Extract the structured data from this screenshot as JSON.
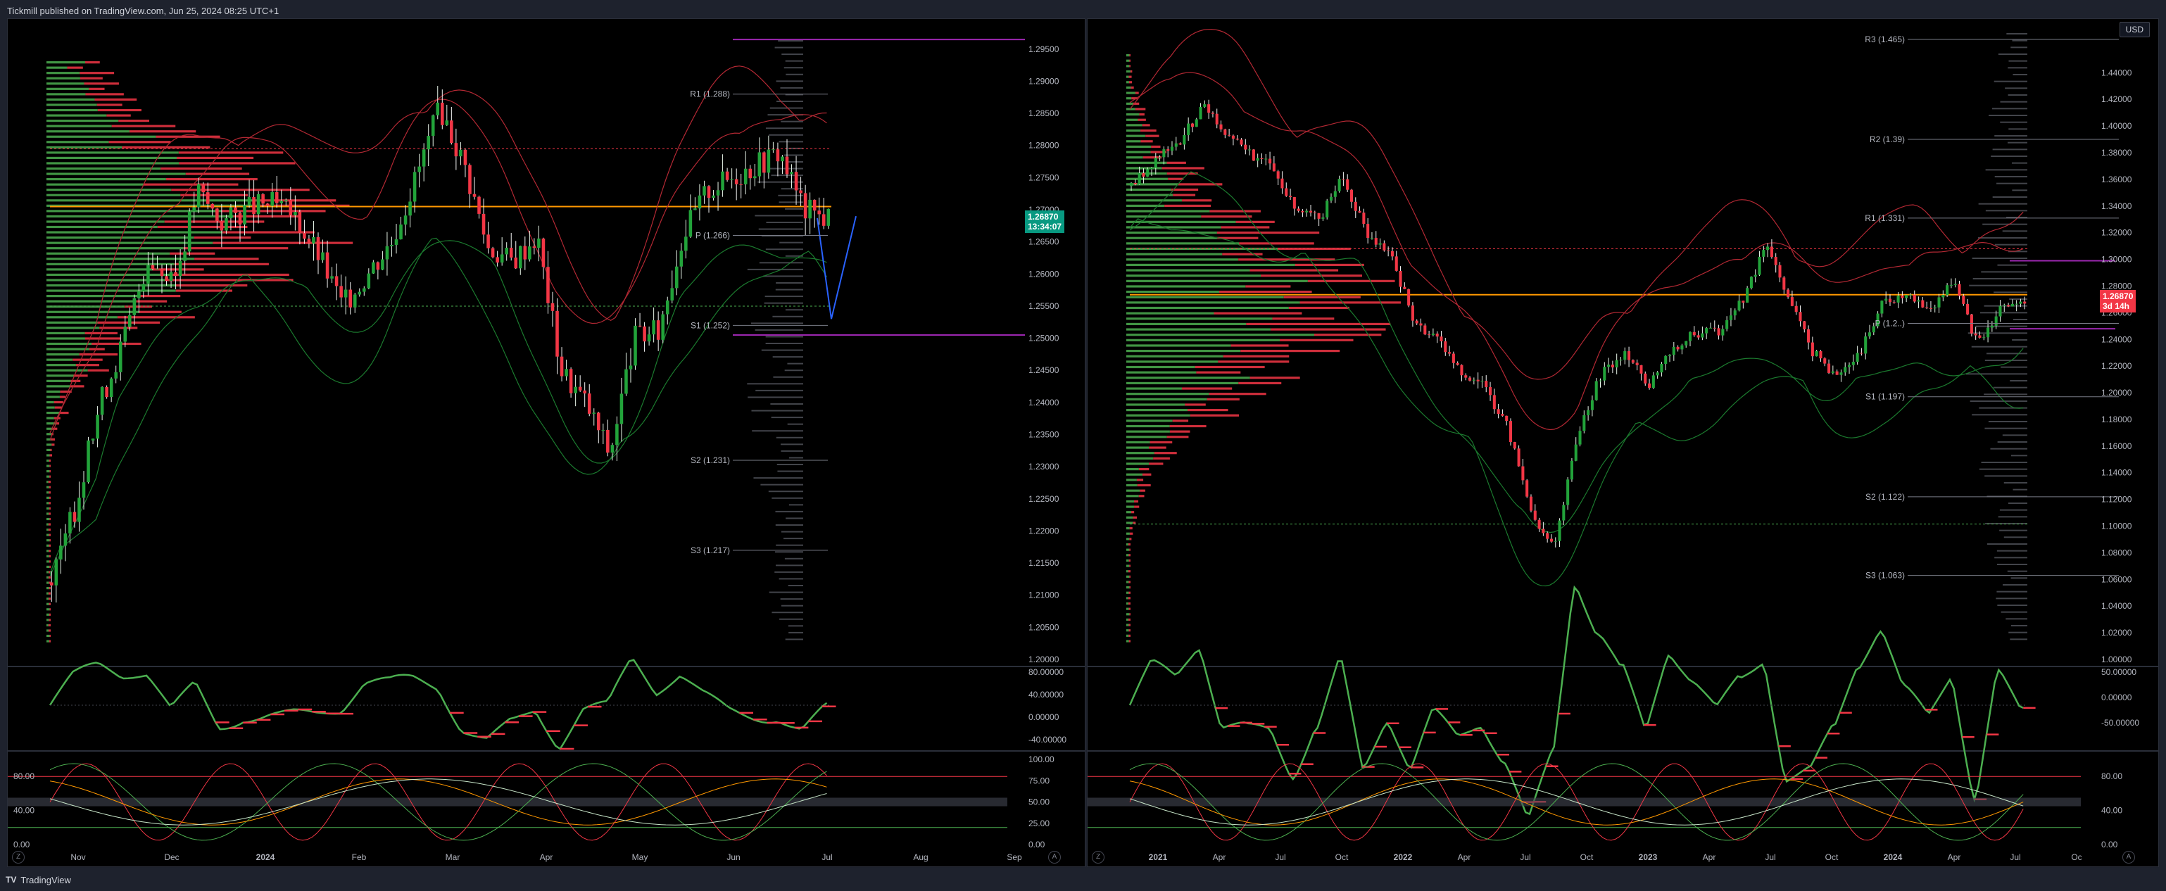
{
  "header": {
    "text": "Tickmill published on TradingView.com, Jun 25, 2024 08:25 UTC+1"
  },
  "footer": {
    "logo": "TV",
    "brand": "TradingView"
  },
  "colors": {
    "up": "#22a33a",
    "down": "#f23645",
    "bg": "#000000",
    "orange": "#ff9800",
    "purple": "#9c27b0",
    "tag_green": "#089981",
    "tag_red": "#f23645"
  },
  "left": {
    "price_tag": {
      "price": "1.26870",
      "countdown": "13:34:07"
    },
    "currency": "",
    "x_labels": [
      "Nov",
      "Dec",
      "2024",
      "Feb",
      "Mar",
      "Apr",
      "May",
      "Jun",
      "Jul",
      "Aug",
      "Sep"
    ],
    "pivots": [
      "R1 (1.288)",
      "P (1.266)",
      "S1 (1.252)",
      "S2 (1.231)",
      "S3 (1.217)"
    ],
    "rsi_axis": [
      "80.00",
      "40.00",
      "0.00"
    ],
    "osc_axis": [
      "80.00000",
      "40.00000",
      "0.00000",
      "-40.00000"
    ],
    "stoch_axis": [
      "100.00",
      "75.00",
      "50.00",
      "25.00",
      "0.00"
    ]
  },
  "right": {
    "price_tag": {
      "price": "1.26870",
      "countdown": "3d 14h"
    },
    "currency": "USD",
    "x_labels": [
      "2021",
      "Apr",
      "Jul",
      "Oct",
      "2022",
      "Apr",
      "Jul",
      "Oct",
      "2023",
      "Apr",
      "Jul",
      "Oct",
      "2024",
      "Apr",
      "Jul",
      "Oc"
    ],
    "pivots": [
      "R3 (1.465)",
      "R2 (1.39)",
      "R1 (1.331)",
      "P (1.2..)",
      "S1 (1.197)",
      "S2 (1.122)",
      "S3 (1.063)"
    ],
    "osc_axis": [
      "50.00000",
      "0.00000",
      "-50.00000"
    ],
    "stoch_axis": [
      "80.00",
      "40.00",
      "0.00"
    ]
  },
  "chart_data": [
    {
      "type": "candlestick",
      "title": "",
      "timeframe_range": [
        "Nov 2023",
        "Jun 2024"
      ],
      "ylim": [
        1.2,
        1.2975
      ],
      "y_ticks": [
        "1.29500",
        "1.29000",
        "1.28500",
        "1.28000",
        "1.27500",
        "1.27000",
        "1.26500",
        "1.26000",
        "1.25500",
        "1.25000",
        "1.24500",
        "1.24000",
        "1.23500",
        "1.23000",
        "1.22500",
        "1.22000",
        "1.21500",
        "1.21000",
        "1.20500",
        "1.20000"
      ],
      "last_price": 1.2687,
      "pivot_levels": {
        "R1": 1.288,
        "P": 1.266,
        "S1": 1.252,
        "S2": 1.231,
        "S3": 1.217
      },
      "close_path": [
        [
          "Nov 1",
          1.212
        ],
        [
          "Nov 8",
          1.224
        ],
        [
          "Nov 15",
          1.24
        ],
        [
          "Nov 22",
          1.25
        ],
        [
          "Dec 1",
          1.263
        ],
        [
          "Dec 8",
          1.258
        ],
        [
          "Dec 15",
          1.273
        ],
        [
          "Dec 22",
          1.268
        ],
        [
          "Jan 2",
          1.27
        ],
        [
          "Jan 10",
          1.271
        ],
        [
          "Jan 20",
          1.269
        ],
        [
          "Feb 1",
          1.263
        ],
        [
          "Feb 5",
          1.255
        ],
        [
          "Feb 15",
          1.26
        ],
        [
          "Feb 25",
          1.265
        ],
        [
          "Mar 5",
          1.275
        ],
        [
          "Mar 8",
          1.286
        ],
        [
          "Mar 15",
          1.277
        ],
        [
          "Mar 22",
          1.264
        ],
        [
          "Mar 29",
          1.262
        ],
        [
          "Apr 5",
          1.266
        ],
        [
          "Apr 12",
          1.245
        ],
        [
          "Apr 19",
          1.24
        ],
        [
          "Apr 22",
          1.232
        ],
        [
          "Apr 30",
          1.25
        ],
        [
          "May 10",
          1.251
        ],
        [
          "May 17",
          1.266
        ],
        [
          "May 24",
          1.273
        ],
        [
          "Jun 1",
          1.275
        ],
        [
          "Jun 7",
          1.277
        ],
        [
          "Jun 12",
          1.279
        ],
        [
          "Jun 18",
          1.27
        ],
        [
          "Jun 24",
          1.2687
        ]
      ],
      "projection": [
        [
          "Jun 24",
          1.2687
        ],
        [
          "Jul 1",
          1.253
        ],
        [
          "Jul 6",
          1.269
        ]
      ]
    },
    {
      "type": "candlestick",
      "title": "",
      "timeframe_range": [
        "Jan 2021",
        "Jun 2024"
      ],
      "ylim": [
        1.0,
        1.475
      ],
      "y_ticks": [
        "1.44000",
        "1.42000",
        "1.40000",
        "1.38000",
        "1.36000",
        "1.34000",
        "1.32000",
        "1.30000",
        "1.28000",
        "1.26000",
        "1.24000",
        "1.22000",
        "1.20000",
        "1.18000",
        "1.16000",
        "1.14000",
        "1.12000",
        "1.10000",
        "1.08000",
        "1.06000",
        "1.04000",
        "1.02000",
        "1.00000"
      ],
      "last_price": 1.2687,
      "pivot_levels": {
        "R3": 1.465,
        "R2": 1.39,
        "R1": 1.331,
        "S1": 1.197,
        "S2": 1.122,
        "S3": 1.063
      },
      "close_path": [
        [
          "Jan 2021",
          1.355
        ],
        [
          "Feb 2021",
          1.375
        ],
        [
          "Apr 2021",
          1.385
        ],
        [
          "Jun 2021",
          1.415
        ],
        [
          "Jul 2021",
          1.395
        ],
        [
          "Sep 2021",
          1.38
        ],
        [
          "Oct 2021",
          1.37
        ],
        [
          "Nov 2021",
          1.335
        ],
        [
          "Dec 2021",
          1.33
        ],
        [
          "Jan 2022",
          1.362
        ],
        [
          "Feb 2022",
          1.32
        ],
        [
          "Mar 2022",
          1.305
        ],
        [
          "Apr 2022",
          1.255
        ],
        [
          "May 2022",
          1.24
        ],
        [
          "Jun 2022",
          1.215
        ],
        [
          "Jul 2022",
          1.205
        ],
        [
          "Aug 2022",
          1.175
        ],
        [
          "Sep 2022",
          1.11
        ],
        [
          "Oct 2022",
          1.085
        ],
        [
          "Nov 2022",
          1.17
        ],
        [
          "Dec 2022",
          1.215
        ],
        [
          "Jan 2023",
          1.23
        ],
        [
          "Feb 2023",
          1.205
        ],
        [
          "Mar 2023",
          1.232
        ],
        [
          "Apr 2023",
          1.245
        ],
        [
          "May 2023",
          1.245
        ],
        [
          "Jun 2023",
          1.27
        ],
        [
          "Jul 2023",
          1.31
        ],
        [
          "Aug 2023",
          1.27
        ],
        [
          "Sep 2023",
          1.23
        ],
        [
          "Oct 2023",
          1.212
        ],
        [
          "Nov 2023",
          1.23
        ],
        [
          "Dec 2023",
          1.27
        ],
        [
          "Jan 2024",
          1.272
        ],
        [
          "Feb 2024",
          1.263
        ],
        [
          "Mar 2024",
          1.286
        ],
        [
          "Apr 2024",
          1.235
        ],
        [
          "May 2024",
          1.265
        ],
        [
          "Jun 2024",
          1.2687
        ]
      ]
    }
  ]
}
